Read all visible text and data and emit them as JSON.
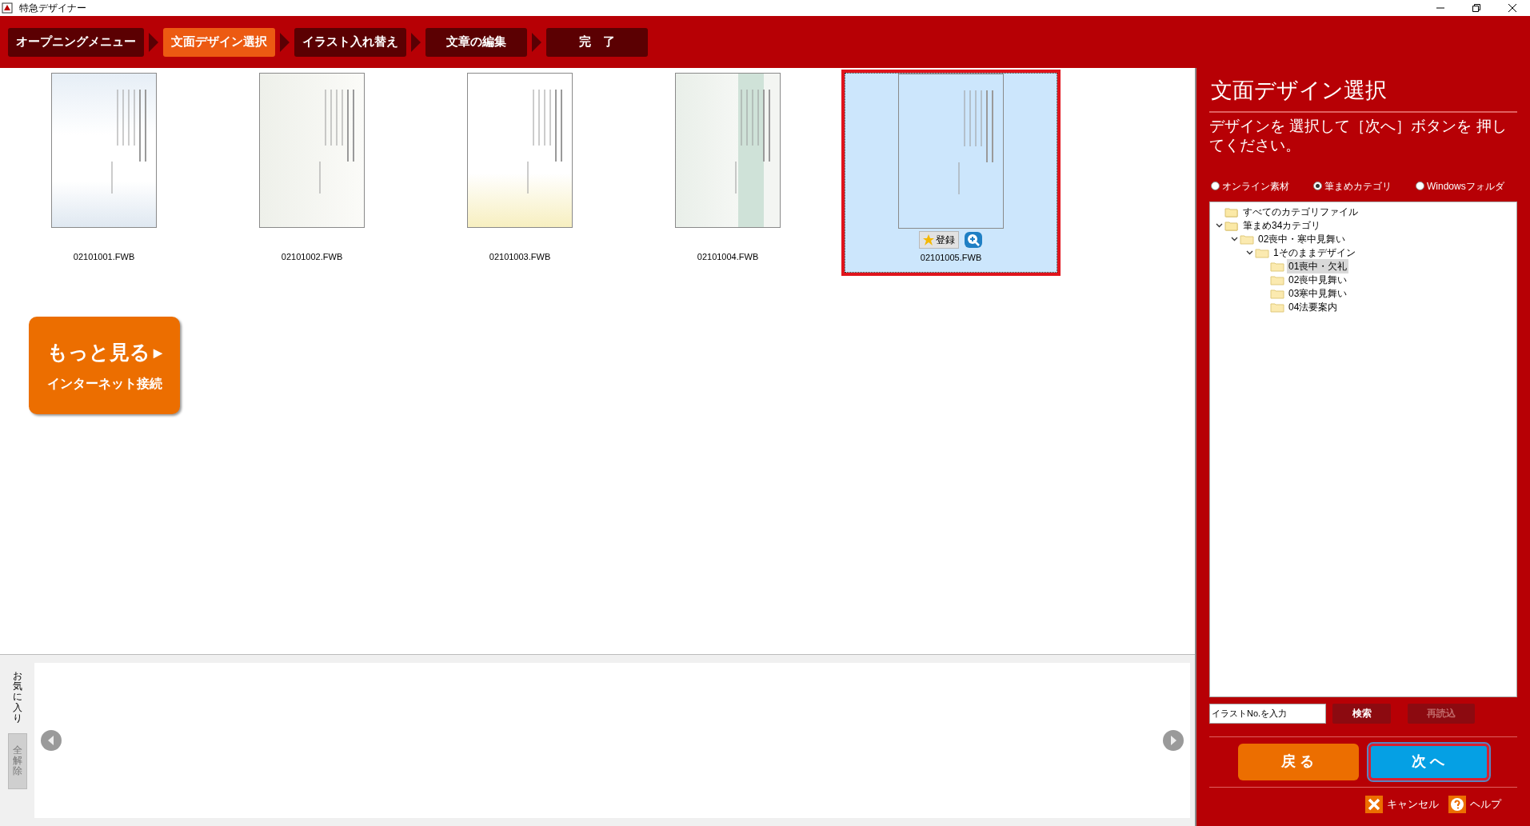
{
  "window": {
    "title": "特急デザイナー"
  },
  "steps": [
    {
      "label": "オープニングメニュー",
      "selected": false
    },
    {
      "label": "文面デザイン選択",
      "selected": true
    },
    {
      "label": "イラスト入れ替え",
      "selected": false
    },
    {
      "label": "文章の編集",
      "selected": false
    },
    {
      "label": "完　了",
      "selected": false
    }
  ],
  "designs": [
    {
      "filename": "02101001.FWB",
      "selected": false
    },
    {
      "filename": "02101002.FWB",
      "selected": false
    },
    {
      "filename": "02101003.FWB",
      "selected": false
    },
    {
      "filename": "02101004.FWB",
      "selected": false
    },
    {
      "filename": "02101005.FWB",
      "selected": true
    }
  ],
  "selected_actions": {
    "register": "登録"
  },
  "more_button": {
    "title": "もっと見る",
    "arrow": "▶",
    "subtitle": "インターネット接続"
  },
  "favorites": {
    "label": "お気に入り",
    "clear_button": "全解除"
  },
  "panel": {
    "title": "文面デザイン選択",
    "instruction": "デザインを 選択して［次へ］ボタンを 押してください。",
    "sources": [
      {
        "label": "オンライン素材",
        "selected": false
      },
      {
        "label": "筆まめカテゴリ",
        "selected": true
      },
      {
        "label": "Windowsフォルダ",
        "selected": false
      }
    ],
    "tree": [
      {
        "label": "すべてのカテゴリファイル",
        "kind": "stack",
        "selected": false
      },
      {
        "label": "筆まめ34カテゴリ",
        "kind": "stack",
        "expanded": true,
        "selected": false,
        "children": [
          {
            "label": "02喪中・寒中見舞い",
            "kind": "folder",
            "expanded": true,
            "selected": false,
            "children": [
              {
                "label": "1そのままデザイン",
                "kind": "folder",
                "expanded": true,
                "selected": false,
                "children": [
                  {
                    "label": "01喪中・欠礼",
                    "kind": "folder",
                    "selected": true
                  },
                  {
                    "label": "02喪中見舞い",
                    "kind": "folder",
                    "selected": false
                  },
                  {
                    "label": "03寒中見舞い",
                    "kind": "folder",
                    "selected": false
                  },
                  {
                    "label": "04法要案内",
                    "kind": "folder",
                    "selected": false
                  }
                ]
              }
            ]
          }
        ]
      }
    ],
    "search": {
      "placeholder": "イラストNo.を入力",
      "search_button": "検索",
      "reload_button": "再読込",
      "reload_disabled": true
    },
    "back_button": "戻 る",
    "next_button": "次 へ",
    "cancel": "キャンセル",
    "help": "ヘルプ"
  }
}
